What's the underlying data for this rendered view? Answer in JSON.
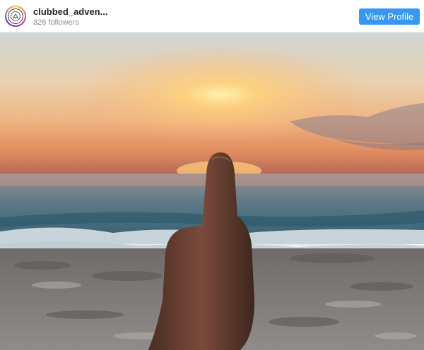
{
  "post_header": {
    "username": "clubbed_adven...",
    "followers": "326 followers",
    "view_profile_label": "View Profile",
    "accent_color": "#3897f0"
  },
  "post": {
    "media_type": "photo"
  }
}
